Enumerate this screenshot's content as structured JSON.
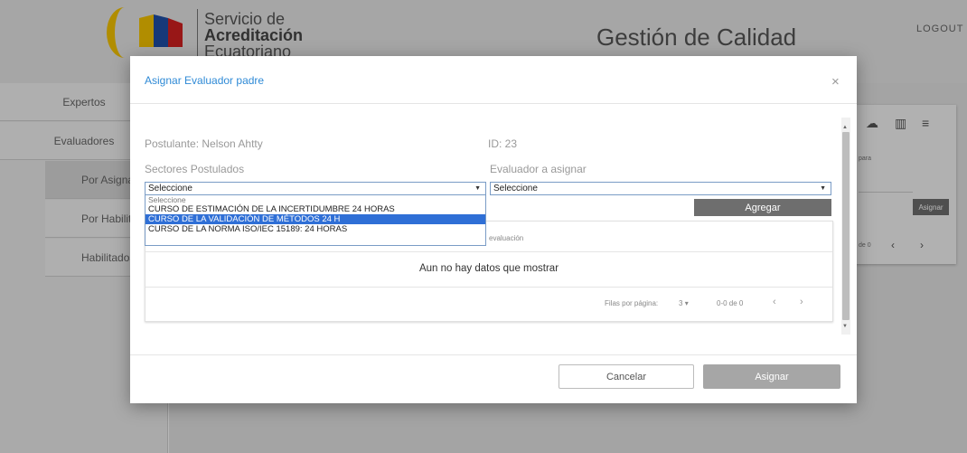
{
  "header": {
    "logo_line1": "Servicio de",
    "logo_line2": "Acreditación",
    "logo_line3": "Ecuatoriano",
    "title": "Gestión de Calidad",
    "logout": "LOGOUT"
  },
  "sidebar": {
    "items": [
      {
        "label": "Expertos"
      },
      {
        "label": "Evaluadores"
      }
    ],
    "subitems": [
      {
        "label": "Por Asignar"
      },
      {
        "label": "Por Habilitar"
      },
      {
        "label": "Habilitados"
      }
    ]
  },
  "right_card": {
    "para_text": "para",
    "assign_label": "Asignar",
    "page_text": "de 0"
  },
  "modal": {
    "title": "Asignar Evaluador padre",
    "close_icon": "×",
    "postulante": "Postulante: Nelson Ahtty",
    "id_text": "ID: 23",
    "sectores_label": "Sectores Postulados",
    "evaluador_label": "Evaluador a asignar",
    "sectores_select": "Seleccione",
    "evaluador_select": "Seleccione",
    "dropdown_options": [
      "Seleccione",
      "CURSO DE ESTIMACIÓN DE LA INCERTIDUMBRE 24 HORAS",
      "CURSO DE LA VALIDACIÓN DE MÉTODOS 24 H",
      "CURSO DE LA NORMA ISO/IEC 15189: 24 HORAS"
    ],
    "highlighted_option": "CURSO DE LA VALIDACIÓN DE MÉTODOS 24 H",
    "agregar_label": "Agregar",
    "table": {
      "column_partial": "evaluación",
      "empty_text": "Aun no hay datos que mostrar",
      "rows_per_page_label": "Filas por página:",
      "rows_per_page_value": "3",
      "range_text": "0-0 de 0"
    },
    "cancel_label": "Cancelar",
    "assign_label": "Asignar"
  },
  "colors": {
    "accent_blue": "#2f8ad6",
    "button_dark": "#6e6e6e",
    "button_disabled": "#a6a6a6",
    "highlight": "#2f6fd6"
  }
}
